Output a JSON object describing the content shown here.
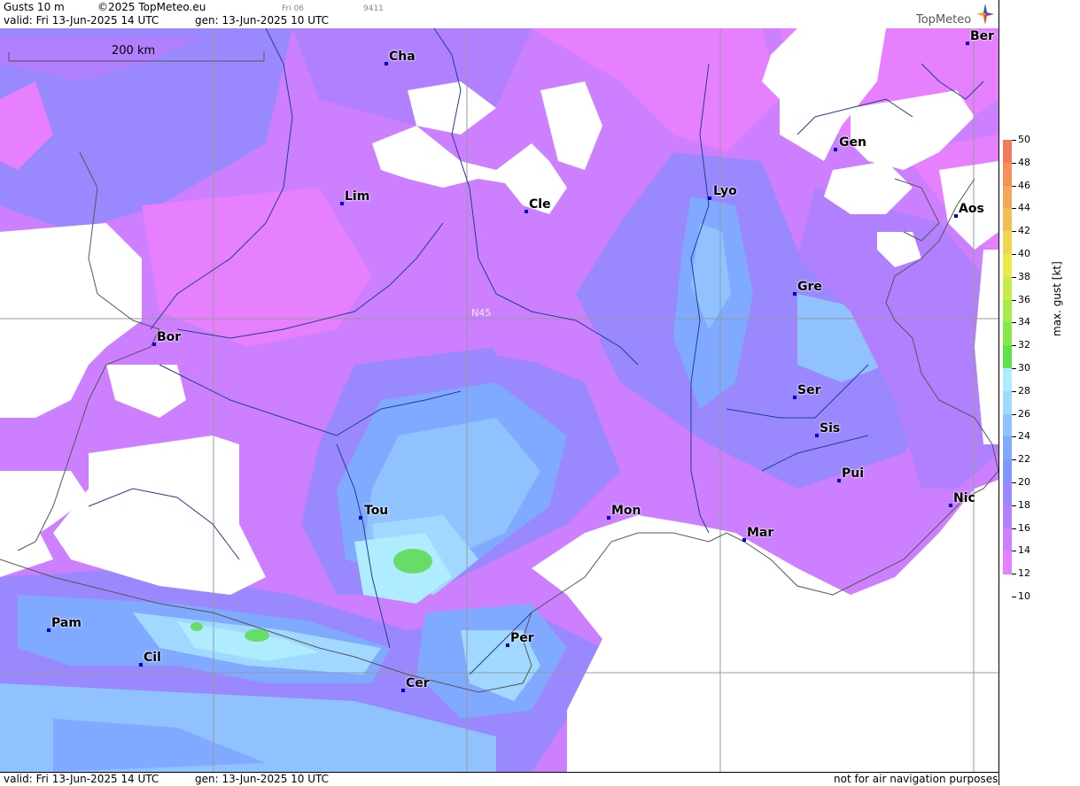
{
  "header": {
    "product": "Gusts 10 m",
    "copyright": "©2025 TopMeteo.eu",
    "valid": "valid:  Fri  13-Jun-2025  14 UTC",
    "generated": "gen: 13-Jun-2025 10 UTC",
    "small_day": "Fri 06",
    "small_code": "9411",
    "logo_text": "TopMeteo"
  },
  "map": {
    "scale_label": "200 km",
    "lat_label": "N45",
    "cities": [
      {
        "name": "Cha"
      },
      {
        "name": "Ber"
      },
      {
        "name": "Gen"
      },
      {
        "name": "Lim"
      },
      {
        "name": "Cle"
      },
      {
        "name": "Lyo"
      },
      {
        "name": "Aos"
      },
      {
        "name": "Gre"
      },
      {
        "name": "Bor"
      },
      {
        "name": "Ser"
      },
      {
        "name": "Sis"
      },
      {
        "name": "Pui"
      },
      {
        "name": "Tou"
      },
      {
        "name": "Mon"
      },
      {
        "name": "Mar"
      },
      {
        "name": "Nic"
      },
      {
        "name": "Pam"
      },
      {
        "name": "Per"
      },
      {
        "name": "Cil"
      },
      {
        "name": "Cer"
      }
    ]
  },
  "legend": {
    "axis_label": "max. gust [kt]",
    "ticks": [
      "50",
      "48",
      "46",
      "44",
      "42",
      "40",
      "38",
      "36",
      "34",
      "32",
      "30",
      "28",
      "26",
      "24",
      "22",
      "20",
      "18",
      "16",
      "14",
      "12",
      "10"
    ],
    "colors": {
      "c12": "#e680ff",
      "c14": "#cc80ff",
      "c16": "#b080ff",
      "c18": "#9a88ff",
      "c20": "#7f95ff",
      "c22": "#80aaff",
      "c24": "#8fc2ff",
      "c26": "#a0d8ff",
      "c28": "#b0ecff",
      "c30": "#66dd66",
      "c32": "#80ee55"
    }
  },
  "footer": {
    "valid": "valid:  Fri  13-Jun-2025  14 UTC",
    "generated": "gen: 13-Jun-2025 10 UTC",
    "disclaimer": "not for air navigation purposes"
  }
}
